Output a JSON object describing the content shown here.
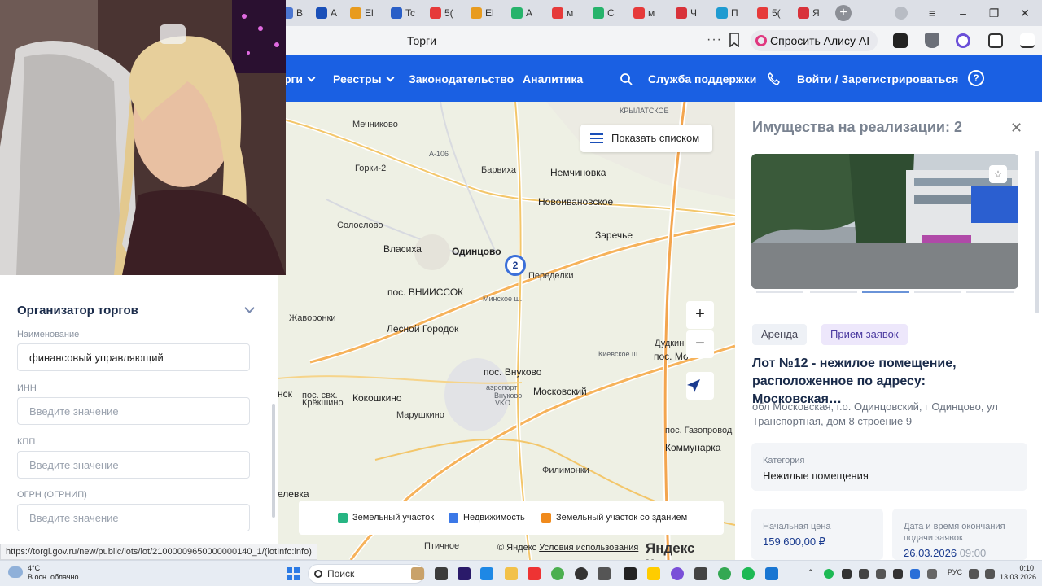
{
  "browser": {
    "tabs": [
      {
        "label": "В",
        "color": "#4b76d1"
      },
      {
        "label": "А",
        "color": "#1a4fb8"
      },
      {
        "label": "El",
        "color": "#e89b1e"
      },
      {
        "label": "Tc",
        "color": "#2a5fc7"
      },
      {
        "label": "5(",
        "color": "#e63a3a"
      },
      {
        "label": "El",
        "color": "#e89b1e"
      },
      {
        "label": "А",
        "color": "#27b36b"
      },
      {
        "label": "м",
        "color": "#e63a3a"
      },
      {
        "label": "С",
        "color": "#27b36b"
      },
      {
        "label": "м",
        "color": "#e63a3a"
      },
      {
        "label": "Ч",
        "color": "#d8323a"
      },
      {
        "label": "П",
        "color": "#1f9bd1"
      },
      {
        "label": "5(",
        "color": "#e63a3a"
      },
      {
        "label": "Я",
        "color": "#d8323a"
      }
    ],
    "page_title": "Торги",
    "alice_label": "Спросить Алису AI"
  },
  "site_nav": {
    "items": [
      {
        "label": "рги",
        "has_chevron": true
      },
      {
        "label": "Реестры",
        "has_chevron": true
      },
      {
        "label": "Законодательство",
        "has_chevron": false
      },
      {
        "label": "Аналитика",
        "has_chevron": false
      }
    ],
    "support": "Служба поддержки",
    "login": "Войти / Зарегистрироваться",
    "help_icon": "?"
  },
  "map": {
    "show_list_button": "Показать списком",
    "cluster_count": "2",
    "zoom_in": "+",
    "zoom_out": "−",
    "places": [
      {
        "name": "Мечниково",
        "kind": "small"
      },
      {
        "name": "КРЫЛАТСКОЕ",
        "kind": "tiny"
      },
      {
        "name": "Горки-2",
        "kind": "small"
      },
      {
        "name": "Барвиха",
        "kind": "small"
      },
      {
        "name": "Немчиновка",
        "kind": "mid"
      },
      {
        "name": "Новоивановское",
        "kind": "mid"
      },
      {
        "name": "Солослово",
        "kind": "small"
      },
      {
        "name": "Заречье",
        "kind": "mid"
      },
      {
        "name": "Власиха",
        "kind": "mid"
      },
      {
        "name": "Одинцово",
        "kind": "big"
      },
      {
        "name": "Переделки",
        "kind": "small"
      },
      {
        "name": "пос. ВНИИССОК",
        "kind": "mid"
      },
      {
        "name": "Жаворонки",
        "kind": "small"
      },
      {
        "name": "Лесной Городок",
        "kind": "mid"
      },
      {
        "name": "Дудкин",
        "kind": "small"
      },
      {
        "name": "пос. Мо",
        "kind": "mid"
      },
      {
        "name": "пос. Внуково",
        "kind": "mid"
      },
      {
        "name": "Московский",
        "kind": "mid"
      },
      {
        "name": "нск",
        "kind": "mid"
      },
      {
        "name": "пос. свх.",
        "kind": "small"
      },
      {
        "name": "Крёкшино",
        "kind": "small"
      },
      {
        "name": "Кокошкино",
        "kind": "mid"
      },
      {
        "name": "аэропорт",
        "kind": "tiny"
      },
      {
        "name": "Внуково",
        "kind": "tiny"
      },
      {
        "name": "VKO",
        "kind": "tiny"
      },
      {
        "name": "Марушкино",
        "kind": "small"
      },
      {
        "name": "пос. Газопровод",
        "kind": "small"
      },
      {
        "name": "Коммунарка",
        "kind": "mid"
      },
      {
        "name": "Филимонки",
        "kind": "small"
      },
      {
        "name": "елевка",
        "kind": "mid"
      },
      {
        "name": "Птичное",
        "kind": "small"
      },
      {
        "name": "А-106",
        "kind": "tiny"
      },
      {
        "name": "Минское ш.",
        "kind": "tiny"
      },
      {
        "name": "Киевское ш.",
        "kind": "tiny"
      }
    ],
    "legend": [
      {
        "label": "Земельный участок",
        "color": "#27b583"
      },
      {
        "label": "Недвижимость",
        "color": "#3b78e7"
      },
      {
        "label": "Земельный участок со зданием",
        "color": "#f08a1c"
      }
    ],
    "copyright": "© Яндекс",
    "terms": "Условия использования",
    "brand": "Яндекс Карты"
  },
  "panel": {
    "title": "Имущества на реализации: 2",
    "chips": [
      "Аренда",
      "Прием заявок"
    ],
    "lot_title": "Лот №12 - нежилое помещение, расположенное по адресу: Московская…",
    "address": "обл Московская, г.о. Одинцовский, г Одинцово, ул Транспортная, дом 8 строение 9",
    "category_label": "Категория",
    "category_value": "Нежилые помещения",
    "price_label": "Начальная цена",
    "price_value": "159 600,00 ₽",
    "deadline_label": "Дата и время окончания подачи заявок",
    "deadline_date": "26.03.2026",
    "deadline_time": "09:00"
  },
  "filters": {
    "section_title": "Организатор торгов",
    "fields": [
      {
        "label": "Наименование",
        "value": "финансовый управляющий",
        "placeholder": ""
      },
      {
        "label": "ИНН",
        "value": "",
        "placeholder": "Введите значение"
      },
      {
        "label": "КПП",
        "value": "",
        "placeholder": "Введите значение"
      },
      {
        "label": "ОГРН (ОГРНИП)",
        "value": "",
        "placeholder": "Введите значение"
      }
    ]
  },
  "status_url": "https://torgi.gov.ru/new/public/lots/lot/21000009650000000140_1/(lotInfo:info)",
  "taskbar": {
    "weather_temp": "4°C",
    "weather_desc": "В осн. облачно",
    "search": "Поиск",
    "lang": "РУС",
    "time": "0:10",
    "date": "13.03.2026"
  }
}
